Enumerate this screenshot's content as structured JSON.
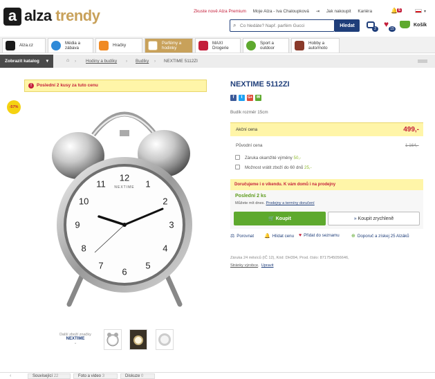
{
  "header": {
    "logo_letter": "a",
    "logo_alza": "alza",
    "logo_trendy": "trendy",
    "links": [
      "Zkuste nově Alza Premium",
      "Moje Alza - Iva Chaloupková",
      "Jak nakoupit",
      "Kariéra"
    ],
    "search_placeholder": "Co hledáte? Např. parfém Gucci",
    "search_button": "Hledat",
    "cart_label": "Košík",
    "badge_red": "5",
    "badge_compare": "2",
    "badge_favorite": "15"
  },
  "categories": [
    {
      "label": "Alza.cz"
    },
    {
      "label": "Média a zábava"
    },
    {
      "label": "Hračky"
    },
    {
      "label": "Parfémy a hodinky"
    },
    {
      "label": "MAXI Drogerie"
    },
    {
      "label": "Sport a outdoor"
    },
    {
      "label": "Hobby a auto/moto"
    }
  ],
  "breadcrumb": {
    "catalog_button": "Zobrazit katalog",
    "items": [
      "Hodiny a budíky",
      "Budíky",
      "NEXTIME 5112ZI"
    ]
  },
  "promo": "Poslední 2 kusy za tuto cenu",
  "discount_badge": "-57%",
  "product": {
    "title": "NEXTIME 5112ZI",
    "subtitle": "Budík rozměr 15cm",
    "price_label": "Akční cena",
    "price_value": "499,-",
    "orig_label": "Původní cena",
    "orig_value": "1 164,-",
    "option1_label": "Záruka okamžité výměny",
    "option1_price": "50,-",
    "option2_label": "Možnost vrátit zboží do 60 dnů",
    "option2_price": "25,-",
    "delivery_note": "Doručujeme i o víkendu. K vám domů i na prodejny",
    "stock": "Poslední 2 ks",
    "stock_sub": "Můžete mít dnes.",
    "stock_link": "Prodejny a termíny doručení",
    "buy_button": "Koupit",
    "quick_buy_button": "Koupit zrychleně",
    "actions": [
      "Porovnat",
      "Hlídat cenu",
      "Přidat do seznamu",
      "Doporuč a získej 25 Alzáků"
    ],
    "meta_line1": "Záruka 24 měsíců (IČ 12),  Kód: DH394,  Prod. číslo: 8717545056646,",
    "meta_link1": "Stránky výrobce",
    "meta_link2": "Upravit"
  },
  "clock": {
    "brand": "NEXTIME",
    "numbers": [
      "12",
      "1",
      "2",
      "3",
      "4",
      "5",
      "6",
      "7",
      "8",
      "9",
      "10",
      "11"
    ]
  },
  "more_brand": {
    "label": "Další zboží značky",
    "brand": "NEXTIME"
  },
  "bottom_tabs": [
    {
      "label": "Související",
      "count": "22"
    },
    {
      "label": "Foto a video",
      "count": "3"
    },
    {
      "label": "Diskuze",
      "count": "0"
    }
  ],
  "colors": {
    "brand_blue": "#1f3e7a",
    "accent_gold": "#c8a15a",
    "price_red": "#c41e3a",
    "buy_green": "#5ea92e"
  }
}
